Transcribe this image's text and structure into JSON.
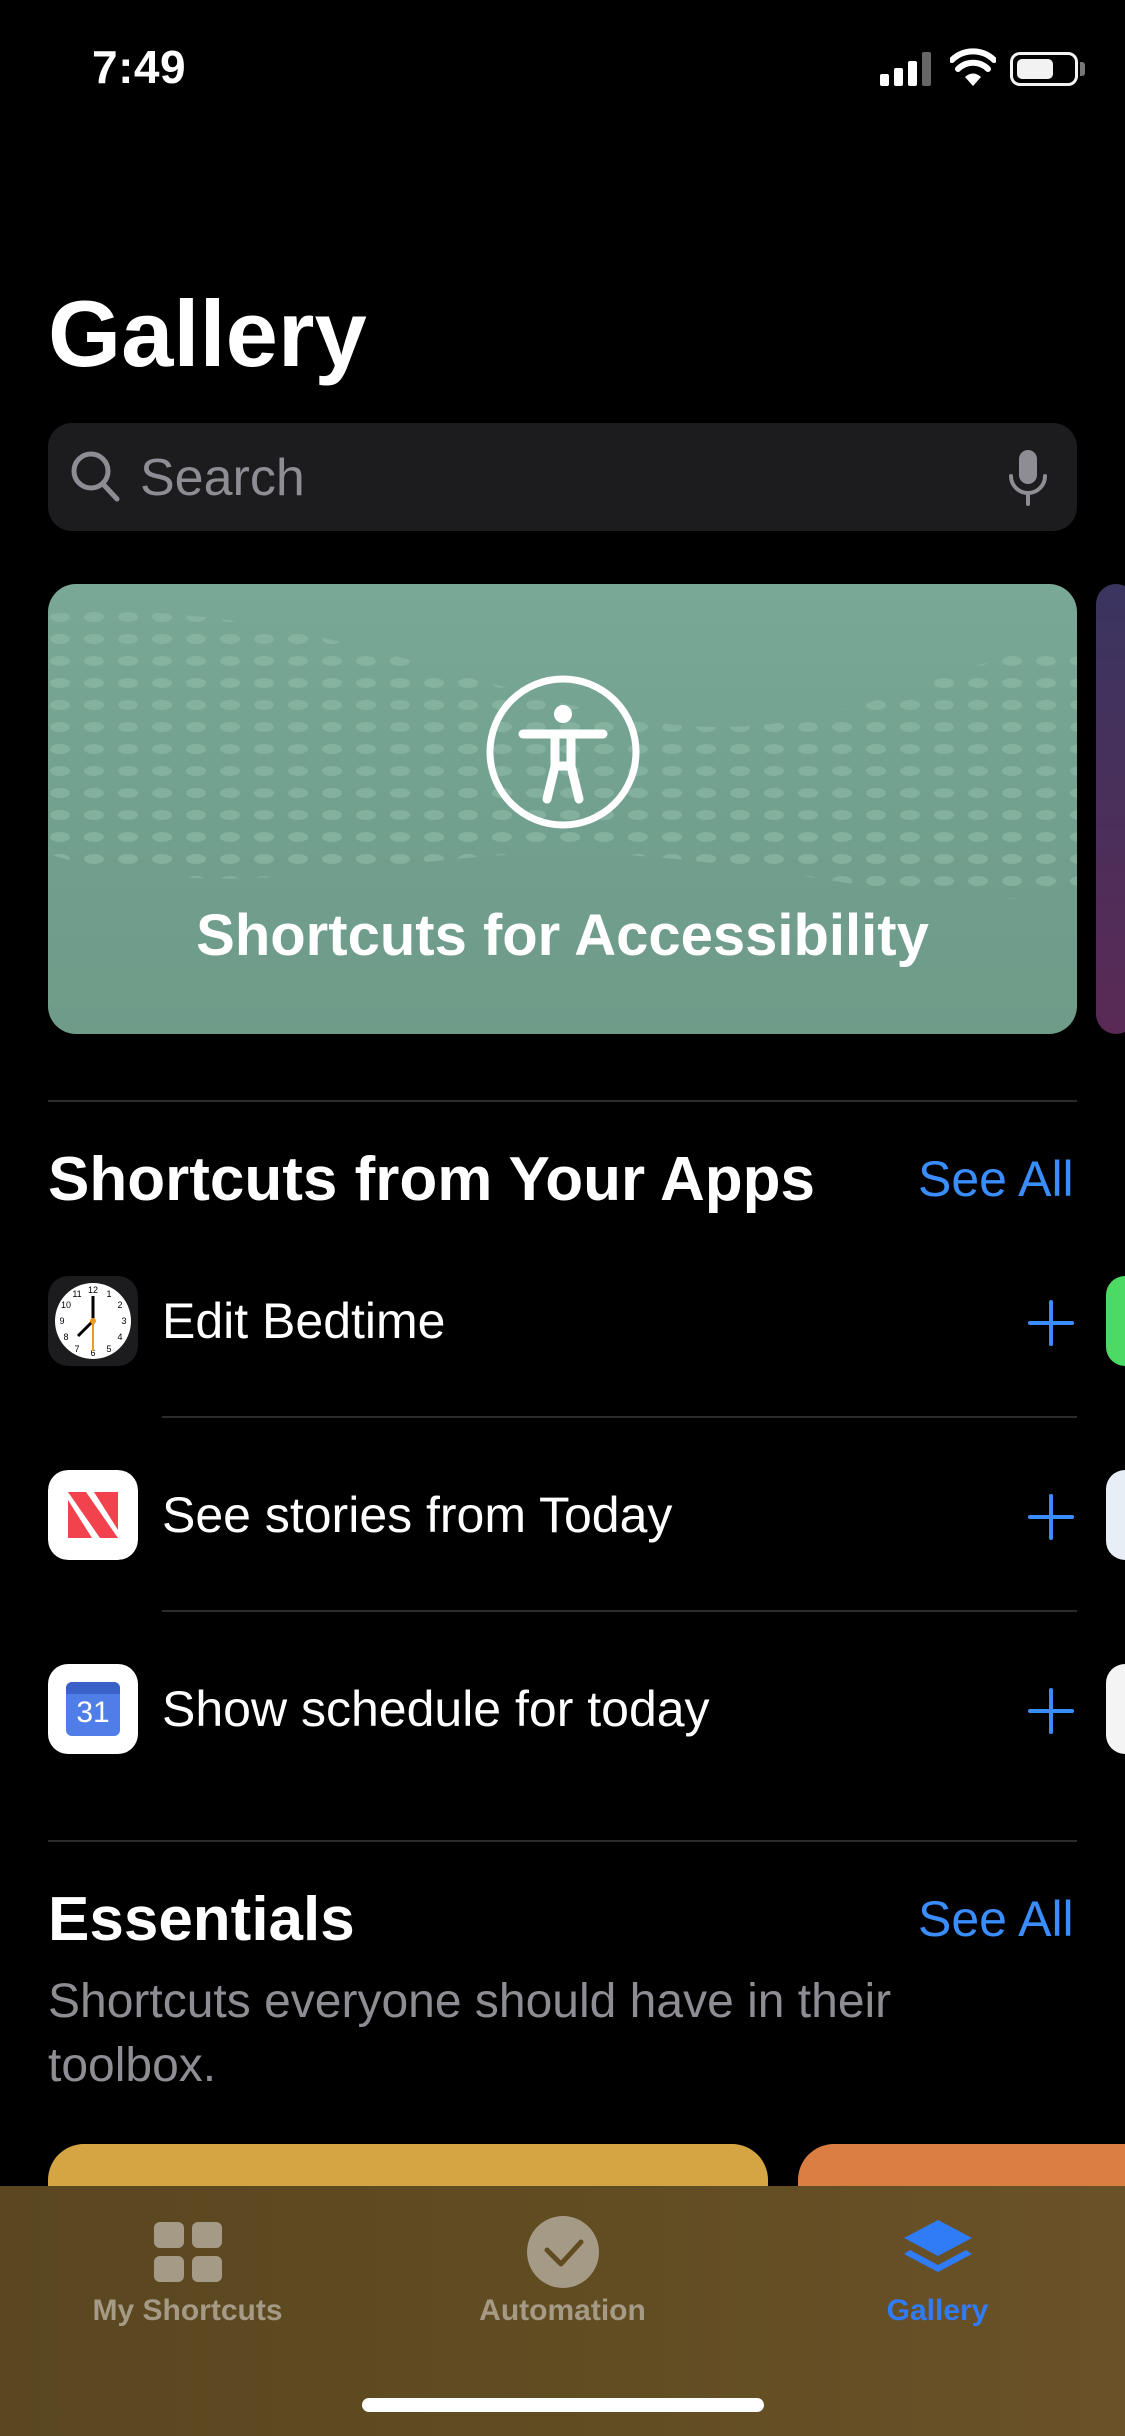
{
  "status_bar": {
    "time": "7:49"
  },
  "page": {
    "title": "Gallery"
  },
  "search": {
    "placeholder": "Search"
  },
  "hero": {
    "title": "Shortcuts for Accessibility"
  },
  "apps_section": {
    "title": "Shortcuts from Your Apps",
    "see_all": "See All",
    "items": [
      {
        "label": "Edit Bedtime",
        "icon": "clock-icon"
      },
      {
        "label": "See stories from Today",
        "icon": "news-icon"
      },
      {
        "label": "Show schedule for today",
        "icon": "calendar-icon",
        "icon_text": "31"
      }
    ]
  },
  "essentials": {
    "title": "Essentials",
    "see_all": "See All",
    "subtitle_line1": "Shortcuts everyone should have in their",
    "subtitle_line2": "toolbox."
  },
  "tabbar": {
    "tabs": [
      {
        "label": "My Shortcuts",
        "icon": "grid-icon",
        "active": false
      },
      {
        "label": "Automation",
        "icon": "checkmark-circle-icon",
        "active": false
      },
      {
        "label": "Gallery",
        "icon": "layers-icon",
        "active": true
      }
    ]
  },
  "colors": {
    "accent": "#3a8dff",
    "hero_green": "#75a391",
    "card_yellow": "#d6a543",
    "card_orange": "#da7e43",
    "tab_inactive": "#a59a85"
  }
}
